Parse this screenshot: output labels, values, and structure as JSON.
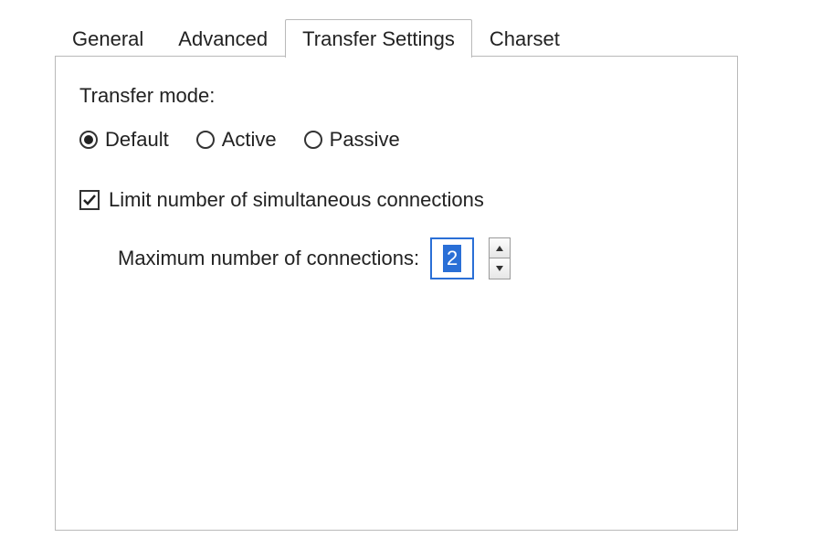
{
  "tabs": {
    "items": [
      {
        "label": "General"
      },
      {
        "label": "Advanced"
      },
      {
        "label": "Transfer Settings"
      },
      {
        "label": "Charset"
      }
    ],
    "active_index": 2
  },
  "transfer": {
    "mode_label": "Transfer mode:",
    "options": {
      "default": "Default",
      "active": "Active",
      "passive": "Passive"
    },
    "selected": "default",
    "limit_checkbox_label": "Limit number of simultaneous connections",
    "limit_checked": true,
    "max_conn_label": "Maximum number of connections:",
    "max_conn_value": "2"
  }
}
